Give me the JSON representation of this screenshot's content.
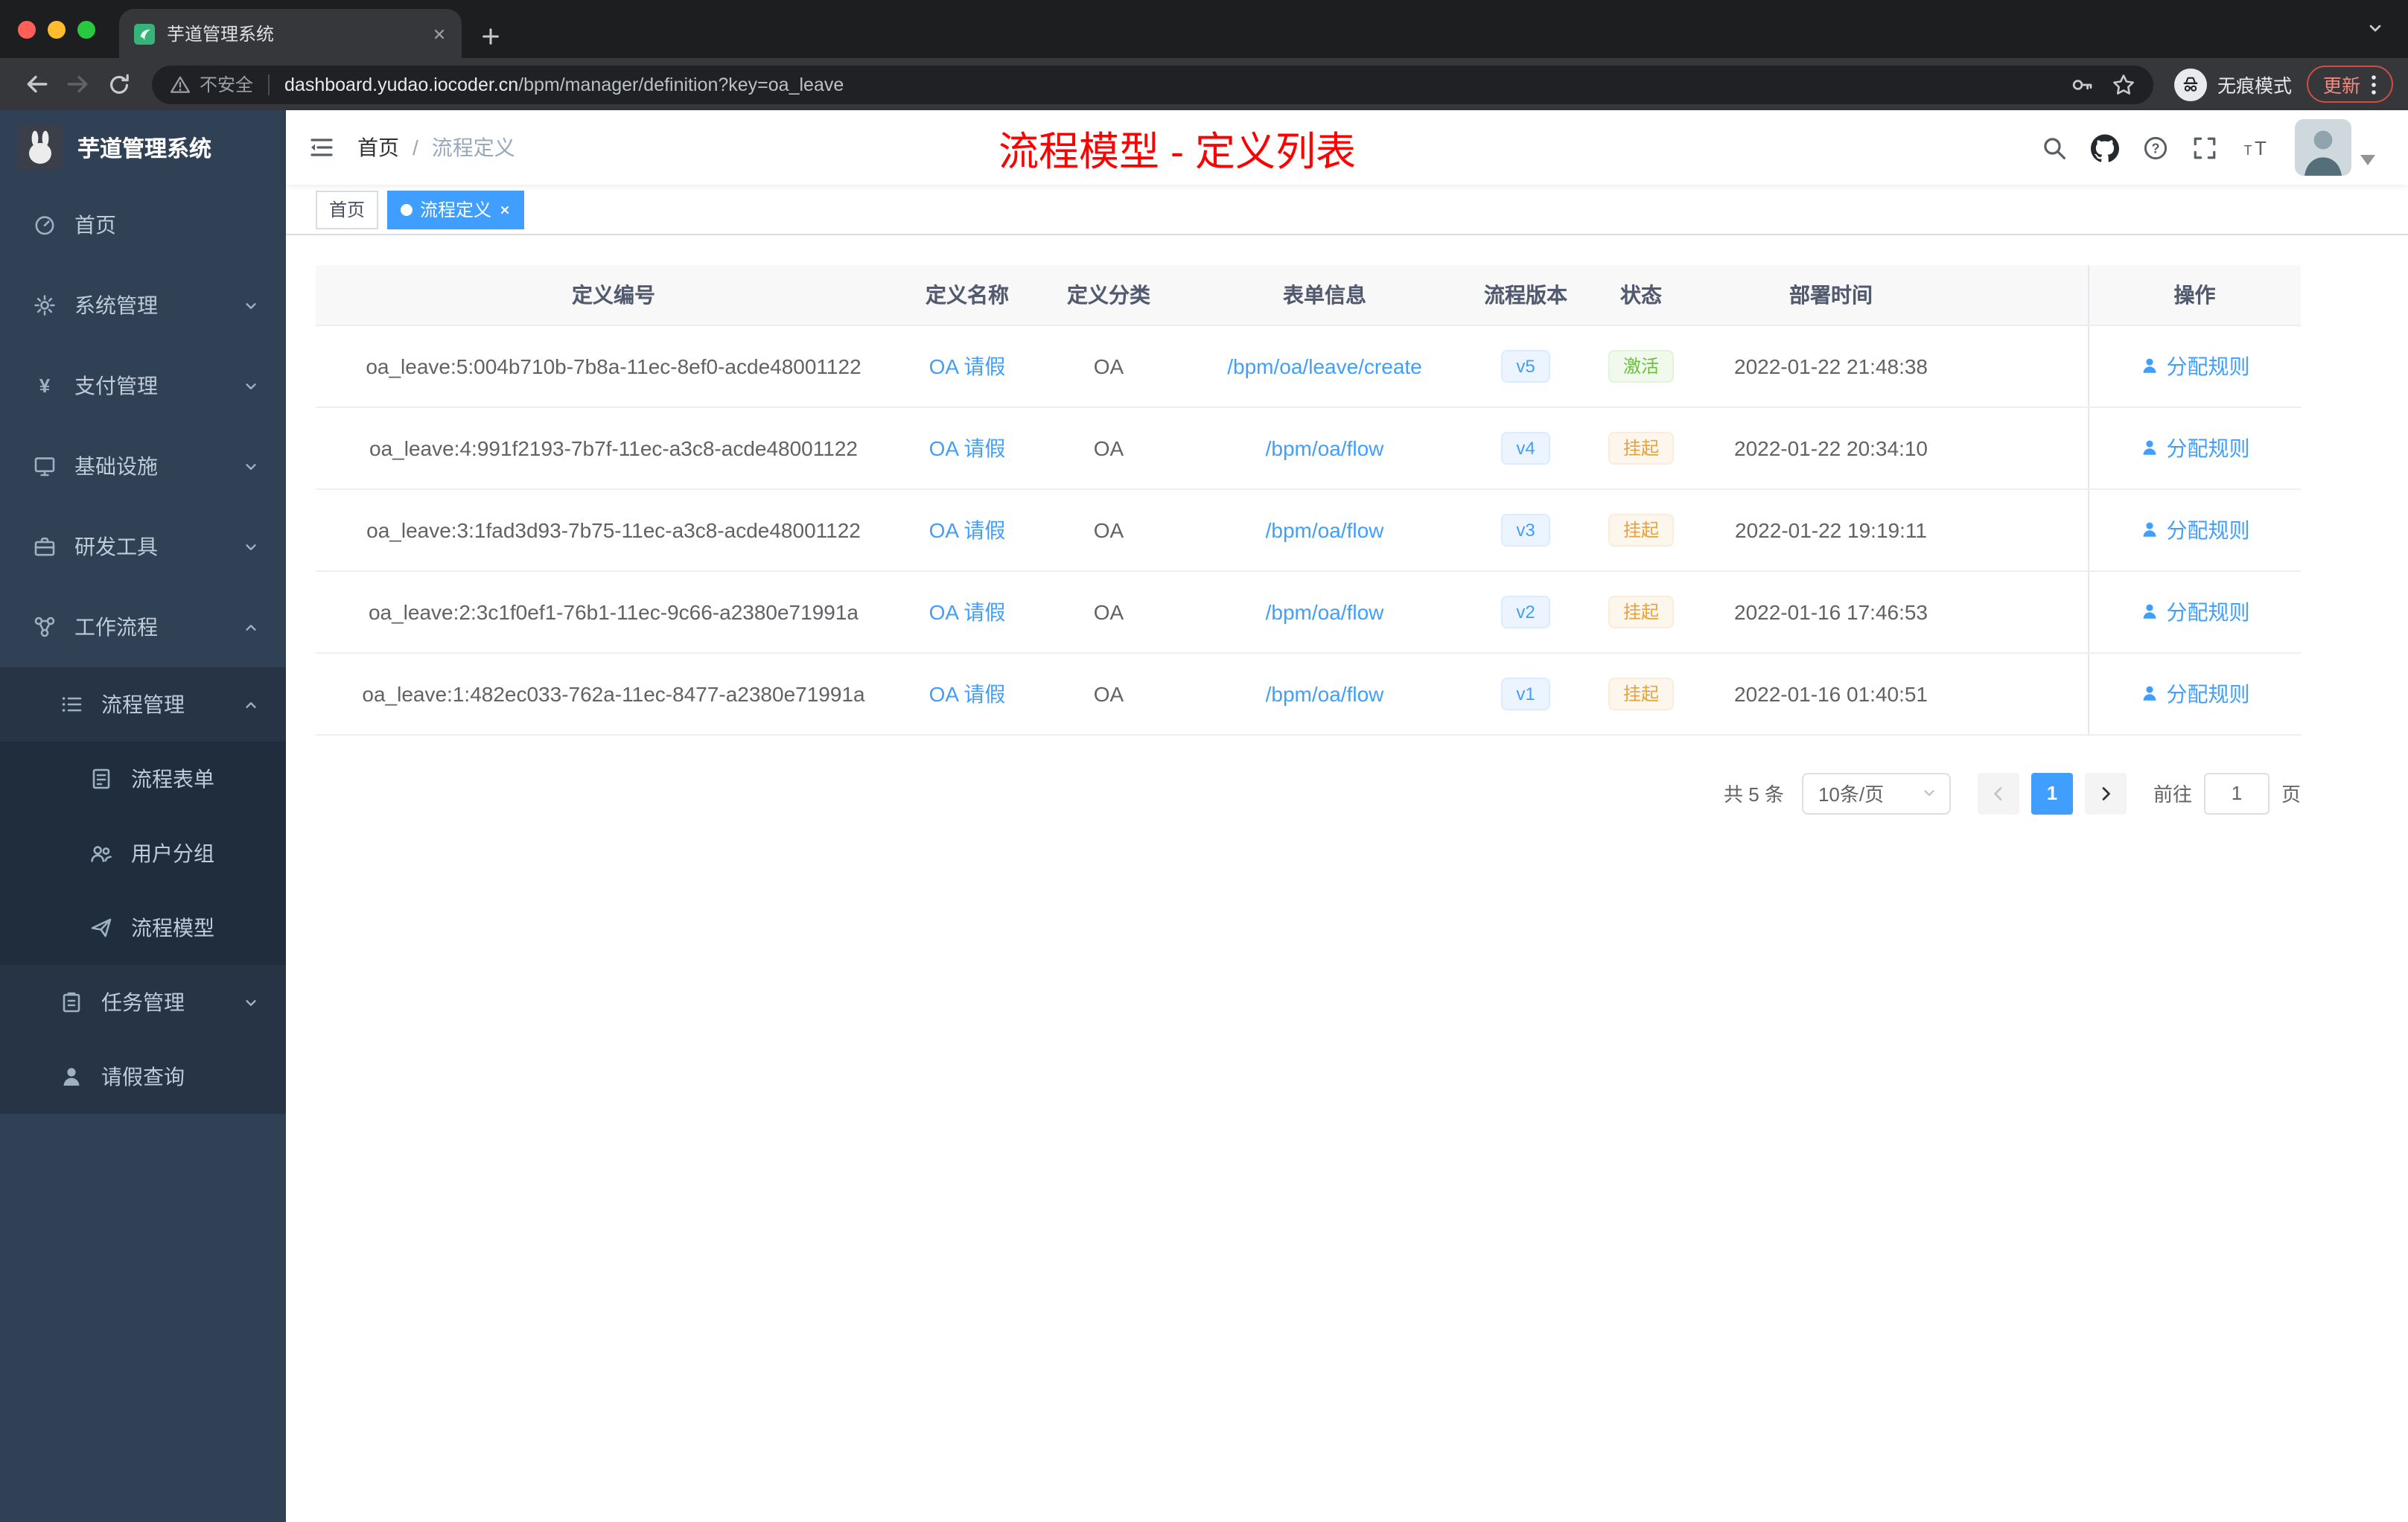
{
  "colors": {
    "primary": "#409eff",
    "title_red": "#ff0000",
    "success": "#67c23a",
    "warning": "#e6a23c",
    "sidebar_bg": "#304156"
  },
  "browser": {
    "tab_title": "芋道管理系统",
    "security_label": "不安全",
    "url_domain": "dashboard.yudao.iocoder.cn",
    "url_path": "/bpm/manager/definition?key=oa_leave",
    "incognito_label": "无痕模式",
    "update_label": "更新"
  },
  "sidebar": {
    "logo_title": "芋道管理系统",
    "items": [
      {
        "label": "首页",
        "icon": "dashboard-icon"
      },
      {
        "label": "系统管理",
        "icon": "gear-icon",
        "expandable": true
      },
      {
        "label": "支付管理",
        "icon": "yen-icon",
        "expandable": true
      },
      {
        "label": "基础设施",
        "icon": "monitor-icon",
        "expandable": true
      },
      {
        "label": "研发工具",
        "icon": "toolbox-icon",
        "expandable": true
      },
      {
        "label": "工作流程",
        "icon": "workflow-icon",
        "expandable": true,
        "expanded": true
      },
      {
        "label": "流程管理",
        "icon": "list-icon",
        "expandable": true,
        "expanded": true
      },
      {
        "label": "流程表单",
        "icon": "form-icon"
      },
      {
        "label": "用户分组",
        "icon": "user-group-icon"
      },
      {
        "label": "流程模型",
        "icon": "paper-plane-icon"
      },
      {
        "label": "任务管理",
        "icon": "clipboard-icon",
        "expandable": true
      },
      {
        "label": "请假查询",
        "icon": "user-icon"
      }
    ]
  },
  "navbar": {
    "breadcrumb_home": "首页",
    "breadcrumb_separator": "/",
    "breadcrumb_current": "流程定义",
    "page_title": "流程模型 - 定义列表"
  },
  "tags": {
    "home": "首页",
    "active": "流程定义"
  },
  "table": {
    "columns": [
      "定义编号",
      "定义名称",
      "定义分类",
      "表单信息",
      "流程版本",
      "状态",
      "部署时间",
      "操作"
    ],
    "rows": [
      {
        "id": "oa_leave:5:004b710b-7b8a-11ec-8ef0-acde48001122",
        "name": "OA 请假",
        "category": "OA",
        "form": "/bpm/oa/leave/create",
        "version": "v5",
        "status": "激活",
        "deploy_time": "2022-01-22 21:48:38",
        "action": "分配规则"
      },
      {
        "id": "oa_leave:4:991f2193-7b7f-11ec-a3c8-acde48001122",
        "name": "OA 请假",
        "category": "OA",
        "form": "/bpm/oa/flow",
        "version": "v4",
        "status": "挂起",
        "deploy_time": "2022-01-22 20:34:10",
        "action": "分配规则"
      },
      {
        "id": "oa_leave:3:1fad3d93-7b75-11ec-a3c8-acde48001122",
        "name": "OA 请假",
        "category": "OA",
        "form": "/bpm/oa/flow",
        "version": "v3",
        "status": "挂起",
        "deploy_time": "2022-01-22 19:19:11",
        "action": "分配规则"
      },
      {
        "id": "oa_leave:2:3c1f0ef1-76b1-11ec-9c66-a2380e71991a",
        "name": "OA 请假",
        "category": "OA",
        "form": "/bpm/oa/flow",
        "version": "v2",
        "status": "挂起",
        "deploy_time": "2022-01-16 17:46:53",
        "action": "分配规则"
      },
      {
        "id": "oa_leave:1:482ec033-762a-11ec-8477-a2380e71991a",
        "name": "OA 请假",
        "category": "OA",
        "form": "/bpm/oa/flow",
        "version": "v1",
        "status": "挂起",
        "deploy_time": "2022-01-16 01:40:51",
        "action": "分配规则"
      }
    ]
  },
  "pagination": {
    "total": "共 5 条",
    "page_size": "10条/页",
    "current_page": "1",
    "goto_label": "前往",
    "goto_value": "1",
    "unit_label": "页"
  }
}
